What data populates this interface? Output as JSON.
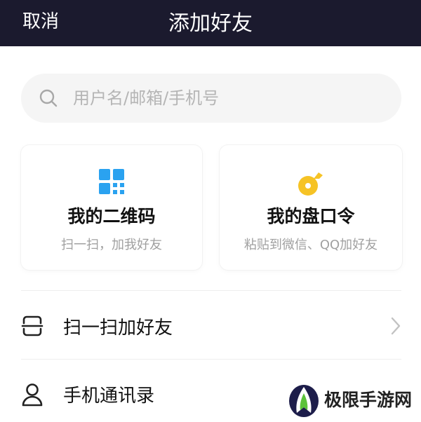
{
  "header": {
    "cancel_label": "取消",
    "title": "添加好友"
  },
  "search": {
    "placeholder": "用户名/邮箱/手机号",
    "icon": "search-icon"
  },
  "cards": [
    {
      "title": "我的二维码",
      "subtitle": "扫一扫，加我好友",
      "icon": "qr-code-icon",
      "icon_color": "#2aa2f0"
    },
    {
      "title": "我的盘口令",
      "subtitle": "粘贴到微信、QQ加好友",
      "icon": "password-key-icon",
      "icon_color": "#f6c325"
    }
  ],
  "rows": [
    {
      "label": "扫一扫加好友",
      "icon": "scan-icon",
      "has_chevron": true
    },
    {
      "label": "手机通讯录",
      "icon": "contacts-person-icon",
      "has_chevron": false
    }
  ],
  "watermark": {
    "text": "极限手游网"
  },
  "colors": {
    "header_bg": "#1b1a2e",
    "search_bg": "#f5f5f5",
    "subtitle_text": "#a0a0a0"
  }
}
